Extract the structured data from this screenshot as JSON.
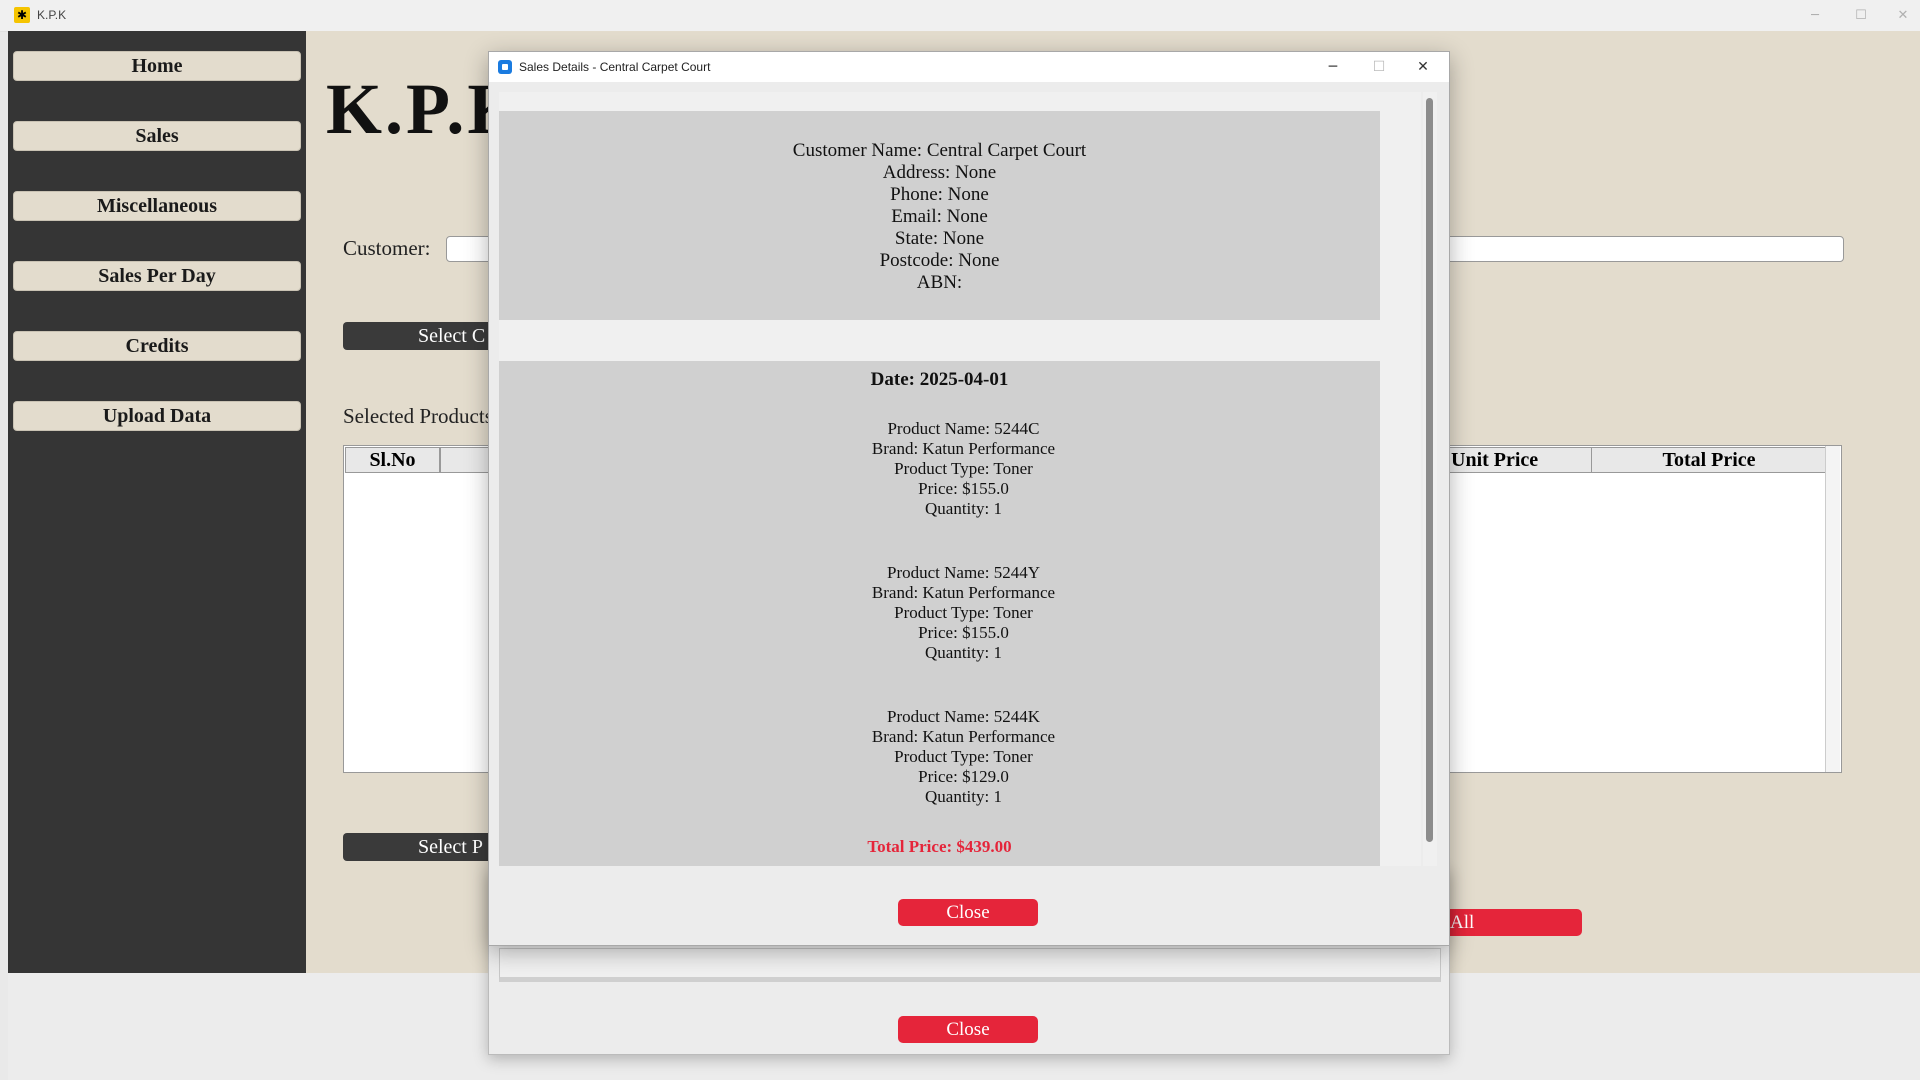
{
  "app": {
    "title": "K.P.K",
    "logo_icon": "app-logo-icon",
    "minimize": "─",
    "maximize": "☐",
    "close": "✕"
  },
  "sidebar": {
    "items": [
      {
        "label": "Home"
      },
      {
        "label": "Sales"
      },
      {
        "label": "Miscellaneous"
      },
      {
        "label": "Sales Per Day"
      },
      {
        "label": "Credits"
      },
      {
        "label": "Upload Data"
      }
    ]
  },
  "main": {
    "title": "K.P.K",
    "customer_label": "Customer:",
    "customer_value": "",
    "select_customer_label": "Select C",
    "selected_products_label": "Selected Products",
    "table_headers": {
      "slno": "Sl.No",
      "unit_price": "Unit Price",
      "total_price": "Total Price"
    },
    "select_product_label": "Select P",
    "clear_all_label": "All"
  },
  "back_dialog": {
    "close_label": "Close"
  },
  "dialog": {
    "title": "Sales Details - Central Carpet Court",
    "minimize": "─",
    "maximize": "☐",
    "close": "✕",
    "customer": {
      "name": "Customer Name: Central Carpet Court",
      "address": "Address: None",
      "phone": "Phone: None",
      "email": "Email: None",
      "state": "State: None",
      "postcode": "Postcode: None",
      "abn": "ABN:"
    },
    "sale": {
      "date": "Date: 2025-04-01",
      "products": [
        {
          "name": "Product Name: 5244C",
          "brand": "Brand: Katun Performance",
          "type": "Product Type: Toner",
          "price": "Price: $155.0",
          "qty": "Quantity: 1"
        },
        {
          "name": "Product Name: 5244Y",
          "brand": "Brand: Katun Performance",
          "type": "Product Type: Toner",
          "price": "Price: $155.0",
          "qty": "Quantity: 1"
        },
        {
          "name": "Product Name: 5244K",
          "brand": "Brand: Katun Performance",
          "type": "Product Type: Toner",
          "price": "Price: $129.0",
          "qty": "Quantity: 1"
        }
      ],
      "total": "Total Price: $439.00",
      "total_color": "#e5253a"
    },
    "close_label": "Close"
  },
  "colors": {
    "sidebar_bg": "#353535",
    "main_bg": "#e3dccd",
    "accent_red": "#e5253a"
  }
}
